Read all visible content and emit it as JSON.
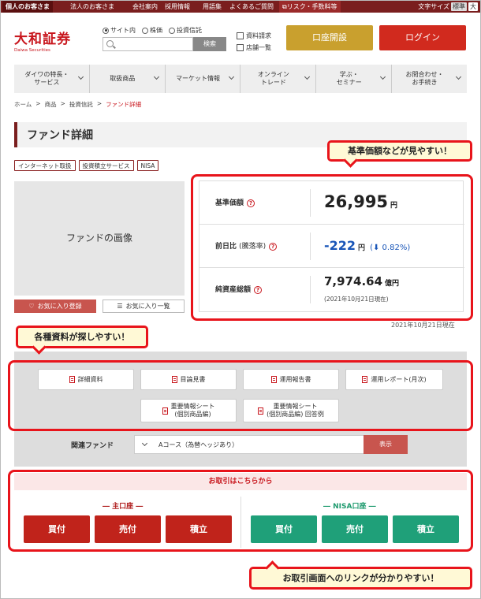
{
  "util_bar": {
    "items": [
      "個人のお客さま",
      "法人のお客さま",
      "会社案内",
      "採用情報",
      "用語集",
      "よくあるご質問",
      "リスク・手数料等"
    ],
    "text_size_label": "文字サイズ",
    "text_size_options": [
      "標準",
      "大"
    ]
  },
  "header": {
    "logo_main": "大和証券",
    "logo_sub": "Daiwa Securities",
    "search_scopes": [
      "サイト内",
      "株価",
      "投資信託"
    ],
    "search_placeholder": "",
    "search_button": "検索",
    "links": [
      "資料請求",
      "店舗一覧"
    ],
    "open_account": "口座開設",
    "login": "ログイン"
  },
  "gnav": [
    "ダイワの特長・\nサービス",
    "取扱商品",
    "マーケット情報",
    "オンライン\nトレード",
    "学ぶ・\nセミナー",
    "お問合わせ・\nお手続き"
  ],
  "breadcrumb": [
    "ホーム",
    "商品",
    "投資信託",
    "ファンド詳細"
  ],
  "page_title": "ファンド詳細",
  "tags": [
    "インターネット取扱",
    "投資積立サービス",
    "NISA"
  ],
  "fund_image_label": "ファンドの画像",
  "favorite": {
    "add": "お気に入り登録",
    "list": "お気に入り一覧"
  },
  "info": {
    "nav": {
      "label": "基準価額",
      "value": "26,995",
      "unit": "円"
    },
    "change": {
      "label": "前日比",
      "label_sub": "(騰落率)",
      "value": "-222",
      "unit": "円",
      "pct": "0.82%"
    },
    "assets": {
      "label": "純資産総額",
      "value": "7,974.64",
      "unit": "億円",
      "asof": "(2021年10月21日現在)"
    }
  },
  "asof_date": "2021年10月21日現在",
  "docs": [
    "詳細資料",
    "目論見書",
    "運用報告書",
    "運用レポート(月次)",
    "重要情報シート\n(個別商品編)",
    "重要情報シート\n(個別商品編) 回答例"
  ],
  "related": {
    "label": "関連ファンド",
    "selected": "Aコース（為替ヘッジあり）",
    "button": "表示"
  },
  "trade": {
    "header": "お取引はこちらから",
    "main_label": "― 主口座 ―",
    "nisa_label": "― NISA口座 ―",
    "main_buttons": [
      "買付",
      "売付",
      "積立"
    ],
    "nisa_buttons": [
      "買付",
      "売付",
      "積立"
    ]
  },
  "annotations": {
    "price": "基準価額などが見やすい！",
    "docs": "各種資料が探しやすい！",
    "trade": "お取引画面へのリンクが分かりやすい！"
  },
  "colors": {
    "brand_red": "#c8161d",
    "gold": "#c9a02e",
    "nisa_green": "#1fa079",
    "negative_blue": "#1a56b8",
    "annotation_red": "#e8141b"
  }
}
